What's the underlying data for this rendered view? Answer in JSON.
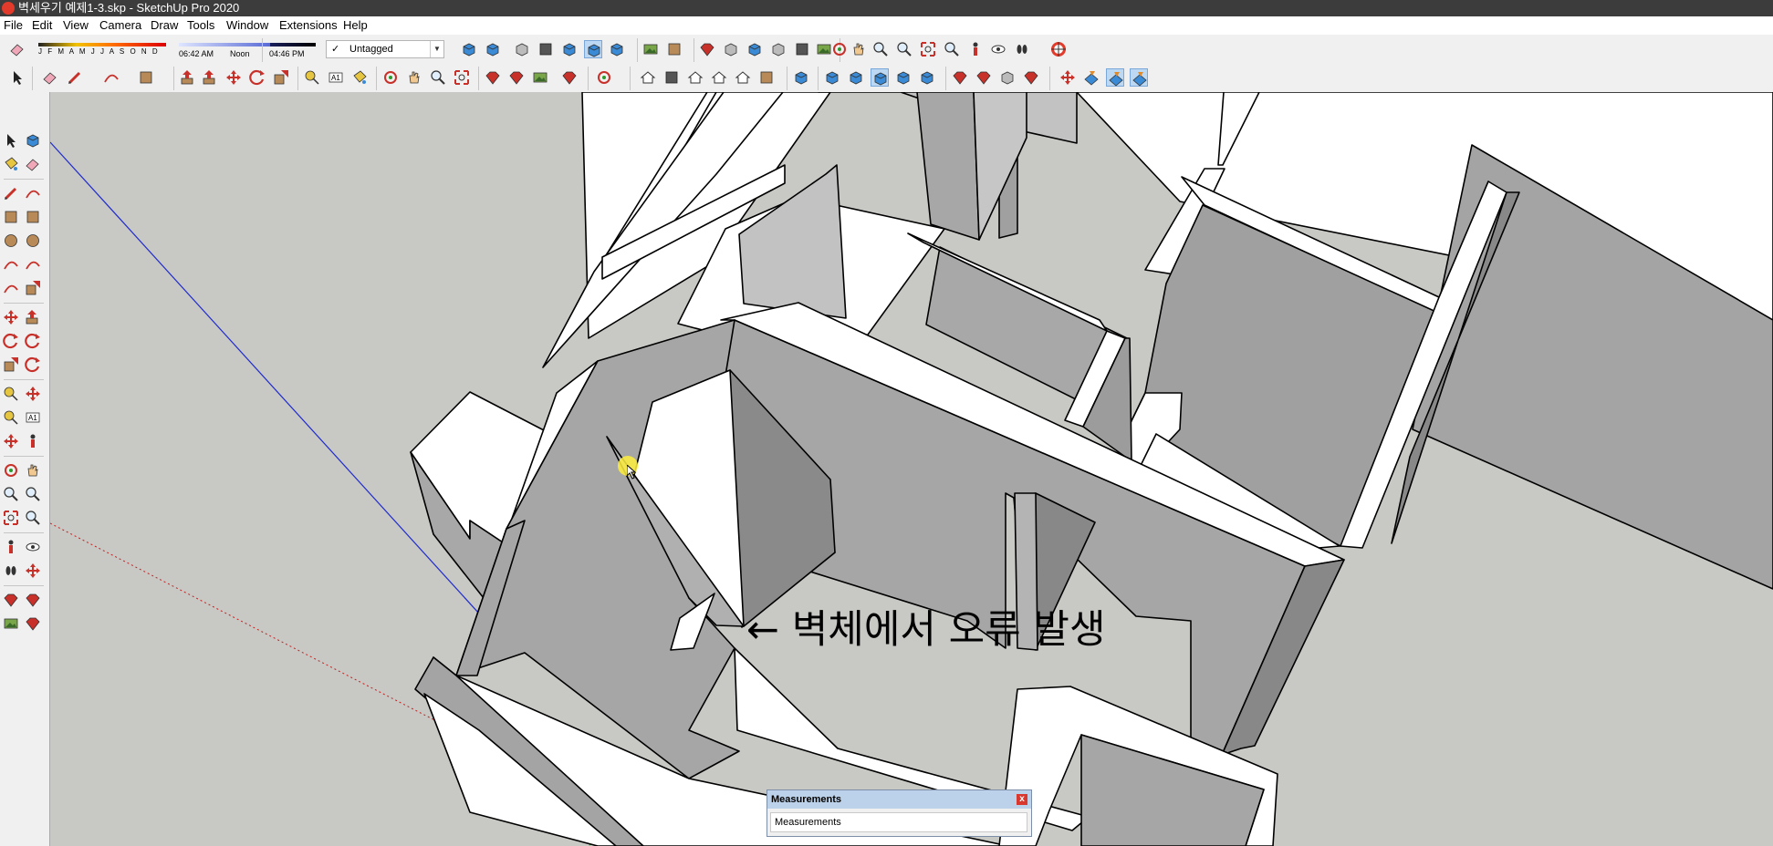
{
  "window": {
    "title": "벽세우기 예제1-3.skp - SketchUp Pro 2020"
  },
  "menu": [
    "File",
    "Edit",
    "View",
    "Camera",
    "Draw",
    "Tools",
    "Window",
    "Extensions",
    "Help"
  ],
  "shadow_settings": {
    "months": "J F M A M J J A S O N D",
    "time_start": "06:42 AM",
    "time_mid": "Noon",
    "time_end": "04:46 PM"
  },
  "tag_selector": {
    "checkmark": "✓",
    "value": "Untagged"
  },
  "annotation": {
    "text": "← 벽체에서 오류 발생"
  },
  "measurements_panel": {
    "title": "Measurements",
    "close": "x",
    "field_label": "Measurements"
  },
  "colors": {
    "axis_blue": "#1f2bd0",
    "axis_red": "#c02020",
    "axis_green": "#2a9a2a",
    "viewport_bg": "#c8c8c4"
  }
}
